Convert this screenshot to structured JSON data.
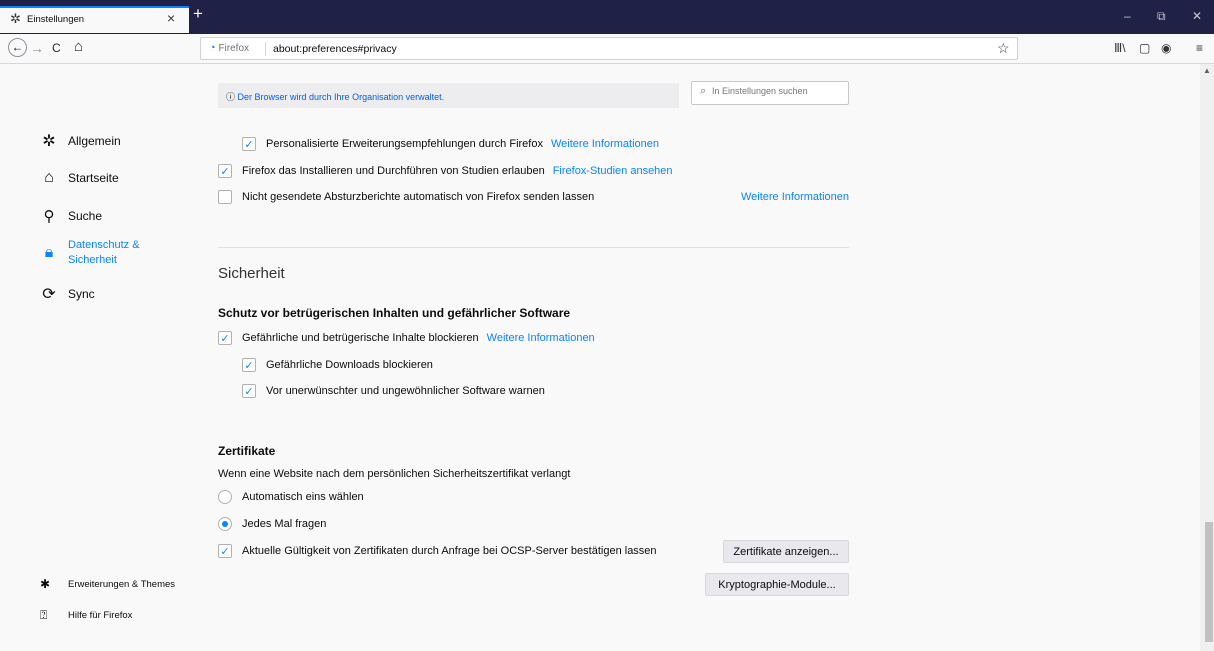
{
  "colors": {
    "titlebar": "#1f2146",
    "accent": "#0a84ff",
    "link": "#0a84ff"
  },
  "tab": {
    "icon": "gear-icon",
    "title": "Einstellungen",
    "close": "×"
  },
  "newtab": "+",
  "window": {
    "minimize": "–",
    "restore": "⧉",
    "close": "✕"
  },
  "nav": {
    "back": "←",
    "forward": "→",
    "reload": "C",
    "home": "⌂",
    "identity": "Firefox",
    "url": "about:preferences#privacy",
    "star": "☆"
  },
  "sidebar": {
    "items": [
      {
        "label": "Allgemein",
        "icon": "gear-icon"
      },
      {
        "label": "Startseite",
        "icon": "home-icon"
      },
      {
        "label": "Suche",
        "icon": "search-icon"
      },
      {
        "label_line1": "Datenschutz &",
        "label_line2": "Sicherheit",
        "icon": "lock-icon",
        "selected": true
      },
      {
        "label": "Sync",
        "icon": "sync-icon"
      }
    ],
    "footer": [
      {
        "label": "Erweiterungen & Themes",
        "icon": "puzzle-icon"
      },
      {
        "label": "Hilfe für Firefox",
        "icon": "help-icon"
      }
    ]
  },
  "policy_notice": "Der Browser wird durch Ihre Organisation verwaltet.",
  "search": {
    "placeholder": "In Einstellungen suchen"
  },
  "data_collection": [
    {
      "label": "Personalisierte Erweiterungsempfehlungen durch Firefox",
      "link": "Weitere Informationen",
      "checked": true
    },
    {
      "label": "Firefox das Installieren und Durchführen von Studien erlauben",
      "link": "Firefox-Studien ansehen",
      "checked": true
    },
    {
      "label": "Nicht gesendete Absturzberichte automatisch von Firefox senden lassen",
      "link": "Weitere Informationen",
      "checked": false
    }
  ],
  "security": {
    "title": "Sicherheit",
    "subtitle": "Schutz vor betrügerischen Inhalten und gefährlicher Software",
    "items": [
      {
        "label": "Gefährliche und betrügerische Inhalte blockieren",
        "link": "Weitere Informationen",
        "checked": true
      },
      {
        "label": "Gefährliche Downloads blockieren",
        "checked": true
      },
      {
        "label": "Vor unerwünschter und ungewöhnlicher Software warnen",
        "checked": true
      }
    ]
  },
  "certificates": {
    "title": "Zertifikate",
    "description": "Wenn eine Website nach dem persönlichen Sicherheitszertifikat verlangt",
    "options": [
      {
        "label": "Automatisch eins wählen",
        "selected": false
      },
      {
        "label": "Jedes Mal fragen",
        "selected": true
      }
    ],
    "ocsp": {
      "label": "Aktuelle Gültigkeit von Zertifikaten durch Anfrage bei OCSP-Server bestätigen lassen",
      "checked": true
    },
    "view_button": "Zertifikate anzeigen...",
    "modules_button": "Kryptographie-Module..."
  },
  "check_glyph": "✓"
}
